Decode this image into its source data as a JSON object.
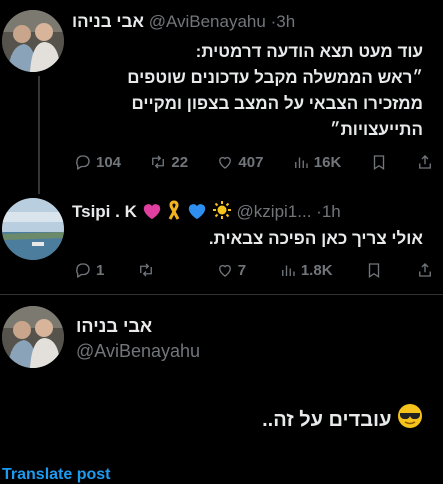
{
  "tweet1": {
    "display_name": "אבי בניהו",
    "handle": "@AviBenayahu",
    "separator": "·",
    "time": "3h",
    "lines": [
      "עוד מעט תצא הודעה דרמטית:",
      "״ראש הממשלה מקבל עדכונים שוטפים",
      "ממזכירו הצבאי על המצב בצפון ומקיים",
      "התייעצויות״"
    ],
    "stats": {
      "replies": "104",
      "retweets": "22",
      "likes": "407",
      "views": "16K"
    }
  },
  "tweet2": {
    "display_name": "Tsipi . K",
    "handle": "@kzipi1...",
    "separator": "·",
    "time": "1h",
    "text": "אולי צריך כאן הפיכה צבאית.",
    "stats": {
      "replies": "1",
      "likes": "7",
      "views": "1.8K"
    }
  },
  "tweet3": {
    "display_name": "אבי בניהו",
    "handle": "@AviBenayahu",
    "text": "עובדים על זה..",
    "translate_label": "Translate post"
  },
  "colors": {
    "background": "#000000",
    "text": "#e7e9ea",
    "muted": "#71767b",
    "link": "#1d9bf0"
  }
}
